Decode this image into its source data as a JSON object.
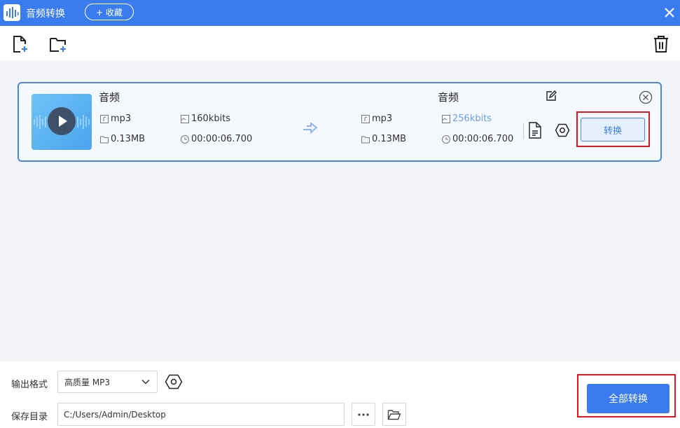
{
  "titlebar": {
    "title": "音频转换",
    "favorite_label": "+ 收藏",
    "accent_color": "#3a7cf0"
  },
  "toolbar": {
    "icons": [
      "add-file-icon",
      "add-folder-icon",
      "trash-icon"
    ]
  },
  "file": {
    "source": {
      "title": "音频",
      "format": "mp3",
      "bitrate": "160kbits",
      "size": "0.13MB",
      "duration": "00:00:06.700"
    },
    "target": {
      "title": "音频",
      "format": "mp3",
      "bitrate": "256kbits",
      "size": "0.13MB",
      "duration": "00:00:06.700"
    },
    "convert_label": "转换"
  },
  "footer": {
    "output_format_label": "输出格式",
    "output_format_value": "高质量 MP3",
    "save_dir_label": "保存目录",
    "save_dir_value": "C:/Users/Admin/Desktop",
    "convert_all_label": "全部转换"
  }
}
